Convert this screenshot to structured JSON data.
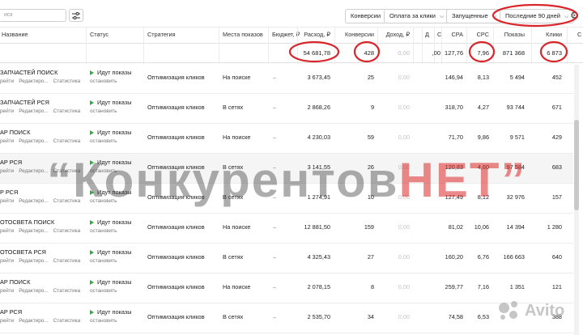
{
  "toolbar": {
    "search_placeholder": "иск",
    "conversions_label": "Конверсии",
    "payment_label": "Оплата за клики",
    "launched_label": "Запущенные",
    "period_label": "Последние 90 дней"
  },
  "columns": {
    "name": "Название",
    "status": "Статус",
    "strategy": "Стратегия",
    "places": "Места показов",
    "budget": "Бюджет, ₽",
    "spend": "Расход, ₽",
    "conversions": "Конверсии",
    "income": "Доход, ₽",
    "d": "Д",
    "c": "С",
    "cpa": "CPA",
    "cpc": "CPC",
    "impressions": "Показы",
    "clicks": "Клики",
    "extra": "С"
  },
  "totals": {
    "spend": "54 681,78",
    "conversions": "428",
    "income": "0,00",
    "d": ",00",
    "cpa": "127,76",
    "cpc": "7,96",
    "impressions": "871 368",
    "clicks": "6 873"
  },
  "rows": [
    {
      "name": "ЗАПЧАСТЕЙ ПОИСК",
      "links": [
        "рейти",
        "Редактиро...",
        "Статистика"
      ],
      "status": "Идут показы",
      "stop": "остановить",
      "strategy": "Оптимизация кликов",
      "places": "На поиске",
      "budget": "–",
      "spend": "3 673,45",
      "conversions": "25",
      "income": "0,00",
      "cpa": "146,94",
      "cpc": "8,13",
      "impressions": "5 494",
      "clicks": "452"
    },
    {
      "name": "ЗАПЧАСТЕЙ РСЯ",
      "links": [
        "рейти",
        "Редактиро...",
        "Статистика"
      ],
      "status": "Идут показы",
      "stop": "остановить",
      "strategy": "Оптимизация кликов",
      "places": "В сетях",
      "budget": "–",
      "spend": "2 868,26",
      "conversions": "9",
      "income": "0,00",
      "cpa": "318,70",
      "cpc": "4,27",
      "impressions": "93 744",
      "clicks": "671"
    },
    {
      "name": "АР ПОИСК",
      "links": [
        "рейти",
        "Редактиро...",
        "Статистика"
      ],
      "status": "Идут показы",
      "stop": "остановить",
      "strategy": "Оптимизация кликов",
      "places": "На поиске",
      "budget": "–",
      "spend": "4 230,03",
      "conversions": "59",
      "income": "0,00",
      "cpa": "71,70",
      "cpc": "9,86",
      "impressions": "9 571",
      "clicks": "429"
    },
    {
      "name": "АР РСЯ",
      "links": [
        "рейти",
        "Редактиро...",
        "Статистика"
      ],
      "status": "Идут показы",
      "stop": "остановить",
      "strategy": "Оптимизация кликов",
      "places": "В сетях",
      "budget": "–",
      "spend": "3 141,55",
      "conversions": "26",
      "income": "0,00",
      "cpa": "120,83",
      "cpc": "4,60",
      "impressions": "97 584",
      "clicks": "683"
    },
    {
      "name": "Р РСЯ",
      "links": [
        "рейти",
        "Редактиро...",
        "Статистика"
      ],
      "status": "Идут показы",
      "stop": "остановить",
      "strategy": "Оптимизация кликов",
      "places": "В сетях",
      "budget": "–",
      "spend": "1 274,91",
      "conversions": "10",
      "income": "0,00",
      "cpa": "127,49",
      "cpc": "8,12",
      "impressions": "32 976",
      "clicks": "157"
    },
    {
      "name": "ОТОСВЕТА ПОИСК",
      "links": [
        "рейти",
        "Редактиро...",
        "Статистика"
      ],
      "status": "Идут показы",
      "stop": "остановить",
      "strategy": "Оптимизация кликов",
      "places": "На поиске",
      "budget": "–",
      "spend": "12 881,50",
      "conversions": "159",
      "income": "0,00",
      "cpa": "81,02",
      "cpc": "10,06",
      "impressions": "14 394",
      "clicks": "1 280"
    },
    {
      "name": "ОТОСВЕТА РСЯ",
      "links": [
        "рейти",
        "Редактиро...",
        "Статистика"
      ],
      "status": "Идут показы",
      "stop": "остановить",
      "strategy": "Оптимизация кликов",
      "places": "В сетях",
      "budget": "–",
      "spend": "4 325,43",
      "conversions": "27",
      "income": "0,00",
      "cpa": "160,20",
      "cpc": "6,76",
      "impressions": "166 663",
      "clicks": "640"
    },
    {
      "name": "АР ПОИСК",
      "links": [
        "рейти",
        "Редактиро...",
        "Статистика"
      ],
      "status": "Идут показы",
      "stop": "остановить",
      "strategy": "Оптимизация кликов",
      "places": "На поиске",
      "budget": "–",
      "spend": "2 078,15",
      "conversions": "8",
      "income": "0,00",
      "cpa": "259,77",
      "cpc": "7,16",
      "impressions": "1 351",
      "clicks": "121"
    },
    {
      "name": "АР РСЯ",
      "links": [
        "рейти",
        "Редактиро...",
        "Статистика"
      ],
      "status": "Идут показы",
      "stop": "остановить",
      "strategy": "Оптимизация кликов",
      "places": "В сетях",
      "budget": "–",
      "spend": "2 535,70",
      "conversions": "34",
      "income": "0,00",
      "cpa": "74,58",
      "cpc": "6,53",
      "impressions": "",
      "clicks": "388"
    }
  ],
  "watermark": {
    "part1": "“Конкурентов",
    "part2": "НЕТ”"
  },
  "avito_logo": "Avito",
  "colors": {
    "accent_red": "#d8262b",
    "play_green": "#2eae3f",
    "highlight_row": "#f5f5f5"
  }
}
